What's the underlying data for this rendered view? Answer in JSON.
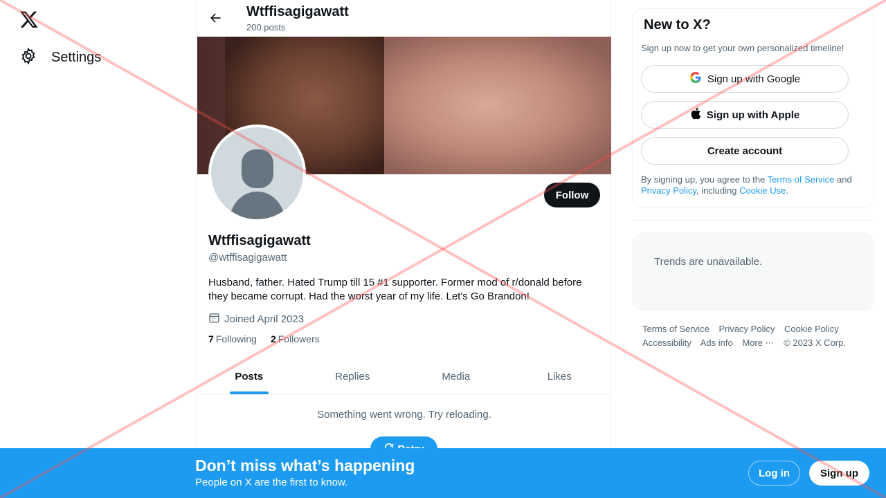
{
  "nav": {
    "logo_icon": "x-logo-icon",
    "settings_label": "Settings"
  },
  "header": {
    "name": "Wtffisagigawatt",
    "post_count": "200 posts"
  },
  "profile": {
    "follow_label": "Follow",
    "display_name": "Wtffisagigawatt",
    "handle": "@wtffisagigawatt",
    "bio": "Husband, father. Hated Trump till 15 #1 supporter. Former mod of r/donald before they became corrupt. Had the worst year of my life. Let's Go Brandon!",
    "joined": "Joined April 2023",
    "following_count": "7",
    "following_label": "Following",
    "followers_count": "2",
    "followers_label": "Followers"
  },
  "tabs": [
    {
      "label": "Posts",
      "active": true
    },
    {
      "label": "Replies",
      "active": false
    },
    {
      "label": "Media",
      "active": false
    },
    {
      "label": "Likes",
      "active": false
    }
  ],
  "feed": {
    "error_message": "Something went wrong. Try reloading.",
    "retry_label": "Retry"
  },
  "signup": {
    "title": "New to X?",
    "subtitle": "Sign up now to get your own personalized timeline!",
    "google_label": "Sign up with Google",
    "apple_label": "Sign up with Apple",
    "create_label": "Create account",
    "terms_prefix": "By signing up, you agree to the ",
    "terms_link": "Terms of Service",
    "terms_and": " and ",
    "privacy_link": "Privacy Policy",
    "terms_including": ", including ",
    "cookie_link": "Cookie Use",
    "terms_end": "."
  },
  "trends": {
    "message": "Trends are unavailable."
  },
  "footer": {
    "links": [
      "Terms of Service",
      "Privacy Policy",
      "Cookie Policy",
      "Accessibility",
      "Ads info",
      "More ⋯",
      "© 2023 X Corp."
    ]
  },
  "bottom_bar": {
    "title": "Don’t miss what’s happening",
    "subtitle": "People on X are the first to know.",
    "login_label": "Log in",
    "signup_label": "Sign up"
  },
  "colors": {
    "accent": "#1d9bf0",
    "text_primary": "#0f1419",
    "text_secondary": "#536471",
    "overlay_x": "#ff4d4d"
  }
}
